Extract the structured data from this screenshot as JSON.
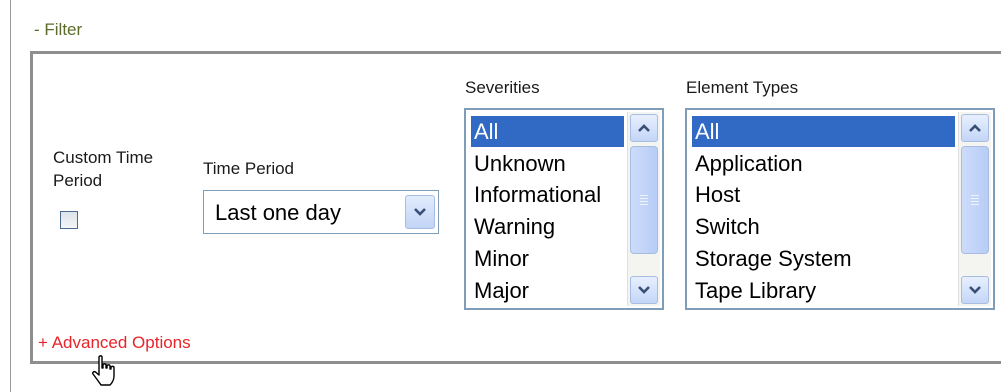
{
  "filter": {
    "toggle_label": "- Filter",
    "custom_time_period": {
      "label_line1": "Custom Time",
      "label_line2": "Period",
      "checked": false
    },
    "time_period": {
      "label": "Time Period",
      "selected": "Last one day"
    },
    "severities": {
      "label": "Severities",
      "options": [
        "All",
        "Unknown",
        "Informational",
        "Warning",
        "Minor",
        "Major"
      ],
      "selected": "All"
    },
    "element_types": {
      "label": "Element Types",
      "options": [
        "All",
        "Application",
        "Host",
        "Switch",
        "Storage System",
        "Tape Library"
      ],
      "selected": "All"
    },
    "advanced_options_label": "+ Advanced Options"
  },
  "colors": {
    "selection": "#316ac5",
    "link_red": "#e8242a",
    "filter_olive": "#5b6b2a",
    "border_blue": "#7f9db9"
  },
  "icons": [
    "chevron-down-icon",
    "scroll-up-arrow-icon",
    "scroll-down-arrow-icon",
    "hand-pointer-cursor-icon"
  ]
}
